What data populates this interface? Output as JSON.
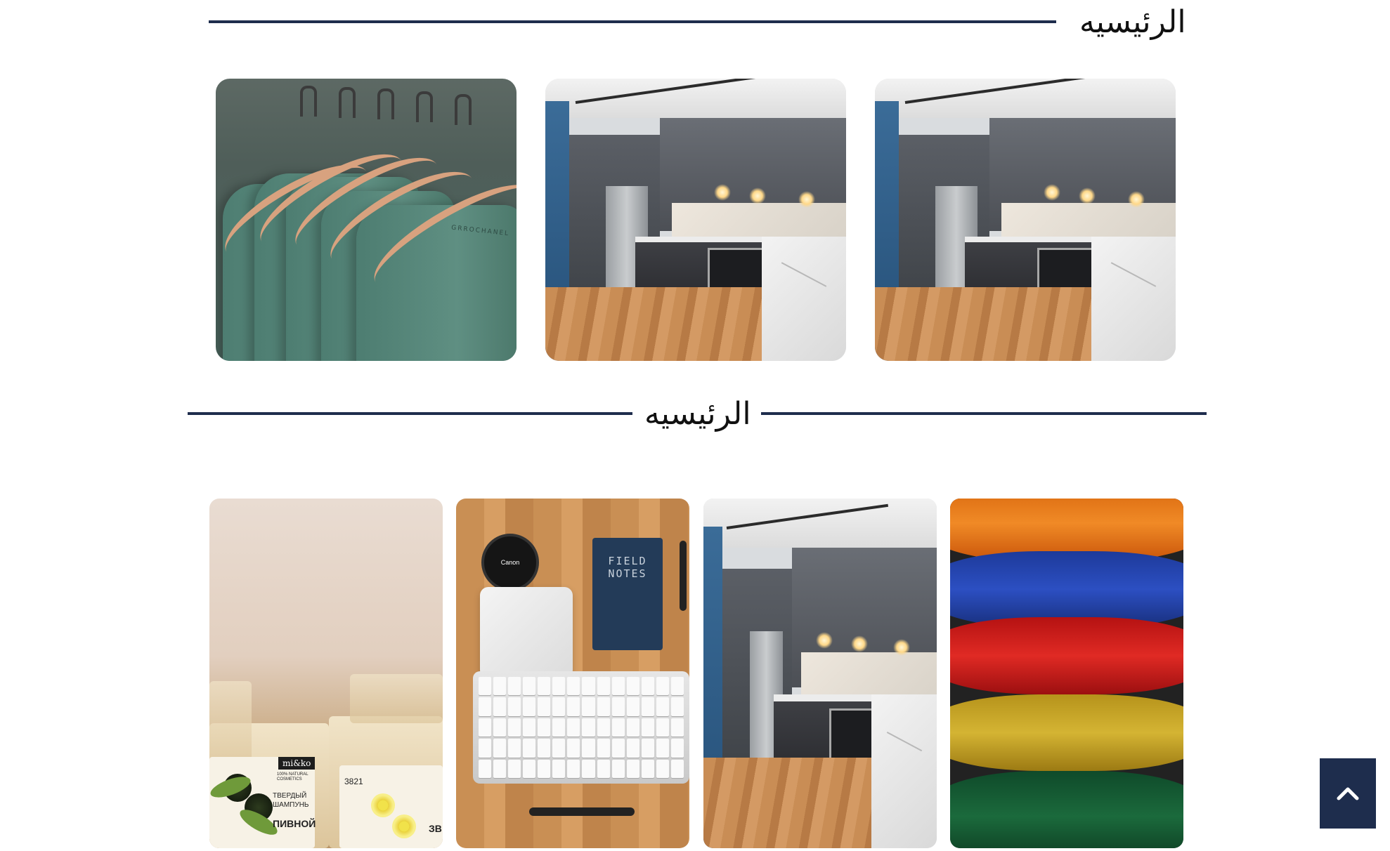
{
  "section1": {
    "title": "الرئيسيه",
    "images": [
      {
        "name": "green-tshirts-on-hangers",
        "label_text": "GRROCHANEL"
      },
      {
        "name": "modern-kitchen"
      },
      {
        "name": "modern-kitchen"
      }
    ]
  },
  "section2": {
    "title": "الرئيسيه",
    "images": [
      {
        "name": "natural-soap-bars",
        "brand": "mi&ko",
        "sublabel": "100% NATURAL COSMETICS",
        "ru_line1": "ТВЕРДЫЙ",
        "ru_line2": "ШАМПУНЬ",
        "ru_line3": "ПИВНОЙ",
        "number": "3821",
        "partial": "ЗВ"
      },
      {
        "name": "desk-flatlay",
        "lens_text": "Canon",
        "notebook_title_1": "FIELD",
        "notebook_title_2": "NOTES"
      },
      {
        "name": "modern-kitchen"
      },
      {
        "name": "colorful-yarn"
      }
    ]
  },
  "back_to_top": {
    "icon": "chevron-up-icon"
  },
  "colors": {
    "rule": "#1e2d4d",
    "button_bg": "#1e2d4d",
    "heading": "#111111"
  }
}
